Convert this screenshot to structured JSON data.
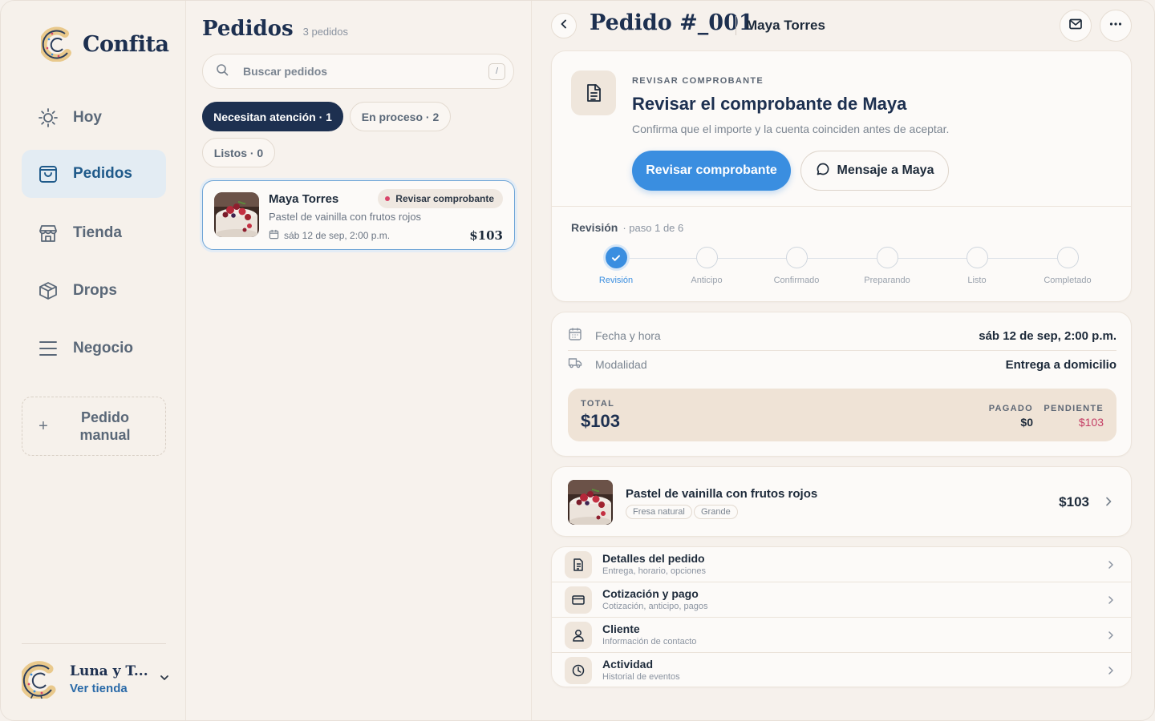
{
  "brand": {
    "name": "Confita"
  },
  "sidebar": {
    "items": [
      {
        "label": "Hoy",
        "icon": "sun-icon"
      },
      {
        "label": "Pedidos",
        "icon": "bag-icon",
        "active": true
      },
      {
        "label": "Tienda",
        "icon": "store-icon"
      },
      {
        "label": "Drops",
        "icon": "layers-icon"
      },
      {
        "label": "Negocio",
        "icon": "menu-icon"
      }
    ],
    "manual_button": {
      "plus": "+",
      "label": "Pedido manual"
    },
    "store": {
      "name": "Luna y T...",
      "link": "Ver tienda"
    }
  },
  "orders": {
    "title": "Pedidos",
    "count": "3 pedidos",
    "search": {
      "placeholder": "Buscar pedidos",
      "shortcut": "/"
    },
    "filters": [
      {
        "label": "Necesitan atención · 1",
        "active": true
      },
      {
        "label": "En proceso · 2",
        "active": false
      },
      {
        "label": "Listos · 0",
        "active": false
      }
    ],
    "list": [
      {
        "customer": "Maya Torres",
        "badge": "Revisar comprobante",
        "product": "Pastel de vainilla con frutos rojos",
        "date": "sáb 12 de sep, 2:00 p.m.",
        "price": "$103"
      }
    ]
  },
  "detail": {
    "title": "Pedido #_001",
    "customer": "Maya Torres",
    "review": {
      "kicker": "REVISAR COMPROBANTE",
      "title": "Revisar el comprobante de Maya",
      "subtitle": "Confirma que el importe y la cuenta coinciden antes de aceptar.",
      "primary": "Revisar comprobante",
      "secondary": "Mensaje a Maya"
    },
    "progress": {
      "label": "Revisión",
      "step_text": "· paso 1 de 6",
      "current_step": 1,
      "total_steps": 6,
      "steps": [
        "Revisión",
        "Anticipo",
        "Confirmado",
        "Preparando",
        "Listo",
        "Completado"
      ]
    },
    "info": {
      "date_label": "Fecha y hora",
      "date_value": "sáb 12 de sep, 2:00 p.m.",
      "mode_label": "Modalidad",
      "mode_value": "Entrega a domicilio",
      "total_label": "TOTAL",
      "total_value": "$103",
      "paid_label": "PAGADO",
      "paid_value": "$0",
      "pending_label": "PENDIENTE",
      "pending_value": "$103"
    },
    "product": {
      "name": "Pastel de vainilla con frutos rojos",
      "tags": [
        "Fresa natural",
        "Grande"
      ],
      "price": "$103"
    },
    "menu": [
      {
        "title": "Detalles del pedido",
        "sub": "Entrega, horario, opciones",
        "icon": "document-icon"
      },
      {
        "title": "Cotización y pago",
        "sub": "Cotización, anticipo, pagos",
        "icon": "card-icon"
      },
      {
        "title": "Cliente",
        "sub": "Información de contacto",
        "icon": "user-icon"
      },
      {
        "title": "Actividad",
        "sub": "Historial de eventos",
        "icon": "clock-icon"
      }
    ]
  },
  "colors": {
    "accent": "#3a8ee0",
    "navy": "#1d3050",
    "pending": "#c43d64",
    "badge_dot": "#d9456a"
  }
}
